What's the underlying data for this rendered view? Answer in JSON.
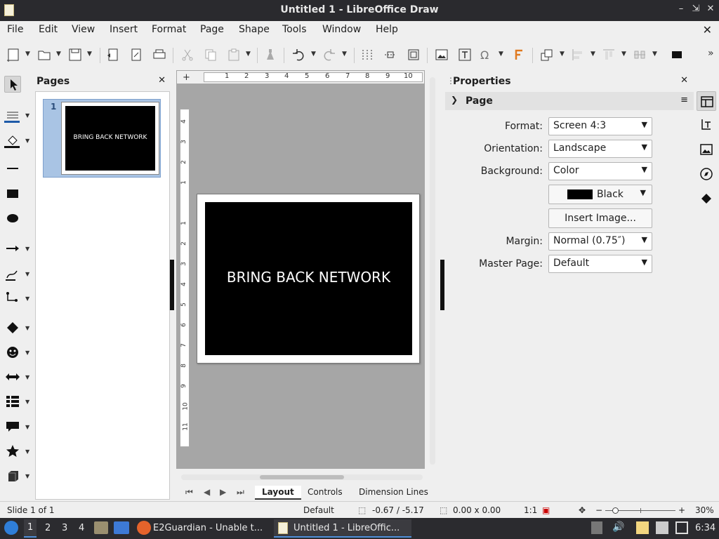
{
  "window": {
    "title": "Untitled 1 - LibreOffice Draw"
  },
  "menu": [
    "File",
    "Edit",
    "View",
    "Insert",
    "Format",
    "Page",
    "Shape",
    "Tools",
    "Window",
    "Help"
  ],
  "pages_panel": {
    "title": "Pages",
    "thumb_number": "1",
    "thumb_text": "BRING BACK NETWORK"
  },
  "canvas": {
    "slide_text": "BRING BACK NETWORK",
    "hruler_labels": [
      "1",
      "2",
      "3",
      "4",
      "5",
      "6",
      "7",
      "8",
      "9",
      "10"
    ],
    "vruler_labels": [
      "4",
      "3",
      "2",
      "1",
      "1",
      "2",
      "3",
      "4",
      "5",
      "6",
      "7",
      "8",
      "9",
      "10",
      "11"
    ]
  },
  "tabs": {
    "items": [
      "Layout",
      "Controls",
      "Dimension Lines"
    ],
    "active": "Layout"
  },
  "properties": {
    "title": "Properties",
    "section": "Page",
    "format_label": "Format:",
    "format_value": "Screen 4:3",
    "orientation_label": "Orientation:",
    "orientation_value": "Landscape",
    "background_label": "Background:",
    "background_value": "Color",
    "color_value": "Black",
    "insert_image": "Insert Image...",
    "margin_label": "Margin:",
    "margin_value": "Normal (0.75″)",
    "master_label": "Master Page:",
    "master_value": "Default"
  },
  "status": {
    "slide": "Slide 1 of 1",
    "layout": "Default",
    "position": "-0.67 / -5.17",
    "size": "0.00 x 0.00",
    "scale": "1:1",
    "zoom": "30%"
  },
  "taskbar": {
    "workspaces": [
      "1",
      "2",
      "3",
      "4"
    ],
    "firefox_task": "E2Guardian - Unable t...",
    "draw_task": "Untitled 1 - LibreOffic...",
    "clock": "6:34"
  },
  "colors": {
    "accent": "#4f8fd8",
    "selection": "#a9c4e4",
    "slide_bg": "#000000"
  }
}
